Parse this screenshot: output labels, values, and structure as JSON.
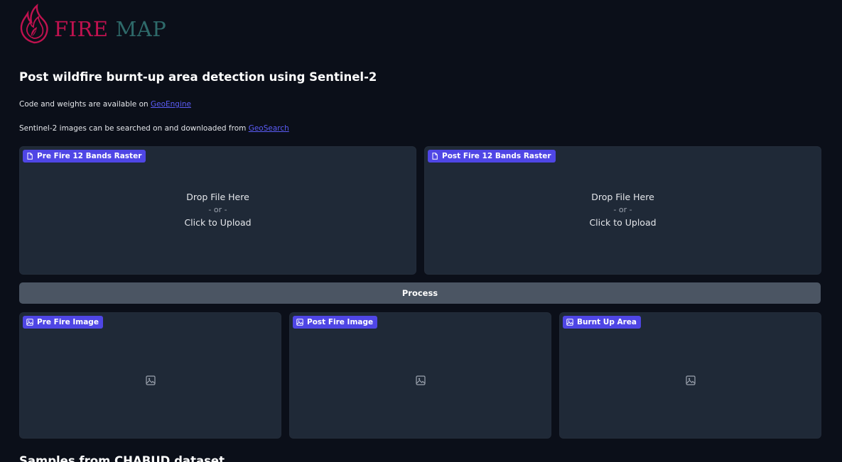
{
  "logo": {
    "fire": "FIRE",
    "map": "MAP",
    "colors": {
      "fire": "#c0124f",
      "map": "#2e6a6a"
    }
  },
  "title": "Post wildfire burnt-up area detection using Sentinel-2",
  "code_line": {
    "text": "Code and weights are available on ",
    "link": "GeoEngine"
  },
  "sentinel_line": {
    "text": "Sentinel-2 images can be searched on and downloaded from ",
    "link": "GeoSearch"
  },
  "uploads": [
    {
      "label": "Pre Fire 12 Bands Raster",
      "icon": "file-icon",
      "drop": "Drop File Here",
      "or": "- or -",
      "click": "Click to Upload"
    },
    {
      "label": "Post Fire 12 Bands Raster",
      "icon": "file-icon",
      "drop": "Drop File Here",
      "or": "- or -",
      "click": "Click to Upload"
    }
  ],
  "process_label": "Process",
  "outputs": [
    {
      "label": "Pre Fire Image",
      "icon": "image-icon"
    },
    {
      "label": "Post Fire Image",
      "icon": "image-icon"
    },
    {
      "label": "Burnt Up Area",
      "icon": "image-icon"
    }
  ],
  "samples_title": "Samples from CHABUD dataset",
  "colors": {
    "background": "#0b0f19",
    "panel": "#1f2937",
    "badge": "#4f46e5",
    "button": "#4b5563",
    "link": "#5b5cf6"
  }
}
